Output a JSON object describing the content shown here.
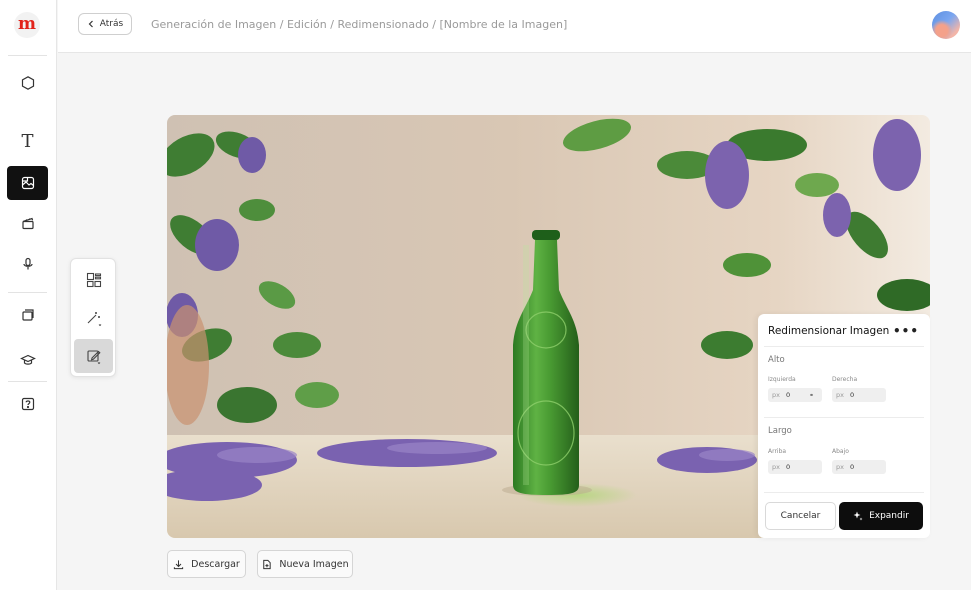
{
  "brand": {
    "logo_letter": "m",
    "logo_color": "#e2231a"
  },
  "sidebar": {
    "items": [
      {
        "name": "shape-tool",
        "icon": "hexagon-icon",
        "active": false
      },
      {
        "name": "text-tool",
        "icon": "text-t-icon",
        "glyph": "T",
        "active": false
      },
      {
        "name": "image-tool",
        "icon": "image-icon",
        "active": true
      },
      {
        "name": "video-tool",
        "icon": "clapperboard-icon",
        "active": false
      },
      {
        "name": "audio-tool",
        "icon": "microphone-icon",
        "active": false
      },
      {
        "name": "gallery",
        "icon": "layers-icon",
        "active": false
      },
      {
        "name": "learning",
        "icon": "graduation-cap-icon",
        "active": false
      },
      {
        "name": "help",
        "icon": "help-icon",
        "active": false
      }
    ]
  },
  "header": {
    "back_label": "Atrás",
    "breadcrumb": "Generación de Imagen / Edición / Redimensionado / [Nombre de la Imagen]"
  },
  "tool_panel": {
    "tools": [
      {
        "name": "layout-tool",
        "icon": "layout-grid-icon",
        "active": false
      },
      {
        "name": "magic-wand-tool",
        "icon": "magic-wand-icon",
        "active": false
      },
      {
        "name": "edit-tool",
        "icon": "edit-square-icon",
        "active": true
      }
    ]
  },
  "resize_panel": {
    "title": "Redimensionar Imagen",
    "more": "•••",
    "alto": {
      "label": "Alto",
      "left_label": "Izquierda",
      "right_label": "Derecha",
      "left_unit": "px",
      "left_value": "0",
      "right_unit": "px",
      "right_value": "0"
    },
    "largo": {
      "label": "Largo",
      "top_label": "Arriba",
      "bottom_label": "Abajo",
      "top_unit": "px",
      "top_value": "0",
      "bottom_unit": "px",
      "bottom_value": "0"
    },
    "cancel_label": "Cancelar",
    "expand_label": "Expandir"
  },
  "actions": {
    "download_label": "Descargar",
    "new_image_label": "Nueva Imagen"
  },
  "colors": {
    "accent": "#111111",
    "panel_bg": "#ffffff",
    "page_bg": "#f5f5f5"
  }
}
